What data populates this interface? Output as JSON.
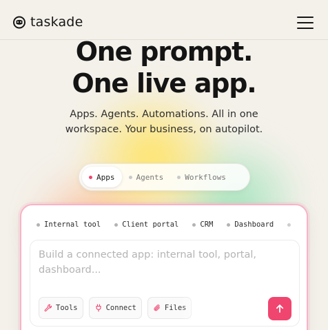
{
  "brand": {
    "name": "taskade",
    "logo_icon": "taskade-logo-icon"
  },
  "header": {
    "menu_icon": "hamburger-menu-icon"
  },
  "hero": {
    "title_line1": "One prompt.",
    "title_line2": "One live app.",
    "subtitle_line1": "Apps. Agents. Automations. All in one",
    "subtitle_line2": "workspace. Your business, on autopilot."
  },
  "modes": [
    {
      "label": "Apps",
      "active": true
    },
    {
      "label": "Agents",
      "active": false
    },
    {
      "label": "Workflows",
      "active": false
    }
  ],
  "suggestions": [
    "Internal tool",
    "Client portal",
    "CRM",
    "Dashboard"
  ],
  "prompt": {
    "placeholder": "Build a connected app: internal tool, portal, dashboard..."
  },
  "tools": [
    {
      "label": "Tools",
      "icon": "wrench-icon"
    },
    {
      "label": "Connect",
      "icon": "plug-icon"
    },
    {
      "label": "Files",
      "icon": "paperclip-icon"
    }
  ],
  "send": {
    "icon": "arrow-up-icon"
  },
  "colors": {
    "accent": "#f0456f",
    "background": "#f4f1ea",
    "text": "#141414"
  }
}
